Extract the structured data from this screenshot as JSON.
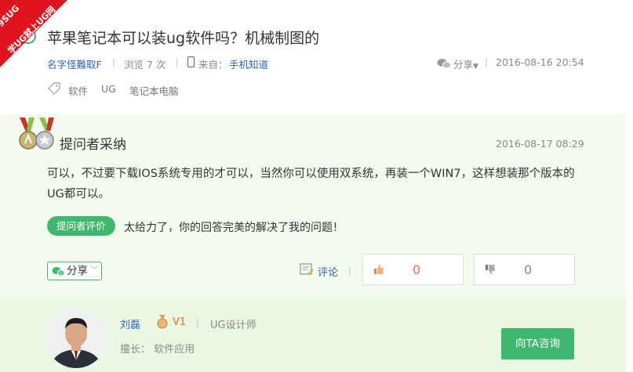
{
  "watermark": {
    "line1": "9SUG",
    "line2": "学UG就上UG网"
  },
  "question": {
    "title": "苹果笔记本可以装ug软件吗？机械制图的",
    "author": "名字怪難取F",
    "views_label": "浏览 7 次",
    "from_label": "来自：",
    "from_source": "手机知道",
    "share_label": "分享",
    "date": "2016-08-16 20:54",
    "tags": [
      "软件",
      "UG",
      "笔记本电脑"
    ]
  },
  "answer": {
    "heading": "提问者采纳",
    "date": "2016-08-17 08:29",
    "body": "可以，不过要下载IOS系统专用的才可以，当然你可以使用双系统，再装一个WIN7，这样想装那个版本的UG都可以。",
    "eval_badge": "提问者评价",
    "eval_text": "太给力了，你的回答完美的解决了我的问题！",
    "share_label": "分享",
    "comment_label": "评论",
    "upvotes": "0",
    "downvotes": "0"
  },
  "answerer": {
    "name": "刘磊",
    "level": "V1",
    "title": "UG设计师",
    "skill_label": "擅长：",
    "skill_value": "软件应用",
    "consult_label": "向TA咨询"
  },
  "colors": {
    "green": "#3fb76e",
    "link": "#2d64b3",
    "red": "#e0141e",
    "answer_bg": "#f3fbee"
  }
}
